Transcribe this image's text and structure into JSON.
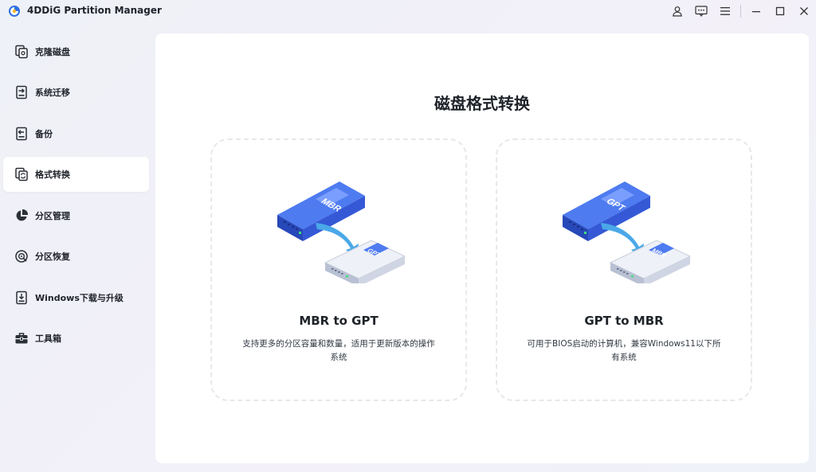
{
  "app": {
    "title": "4DDiG Partition Manager"
  },
  "titlebar": {
    "icons": [
      "user-icon",
      "feedback-icon",
      "menu-icon",
      "minimize-icon",
      "maximize-icon",
      "close-icon"
    ]
  },
  "sidebar": {
    "items": [
      {
        "label": "克隆磁盘",
        "icon": "clone-disk-icon"
      },
      {
        "label": "系统迁移",
        "icon": "system-migrate-icon"
      },
      {
        "label": "备份",
        "icon": "backup-icon"
      },
      {
        "label": "格式转换",
        "icon": "format-convert-icon",
        "active": true
      },
      {
        "label": "分区管理",
        "icon": "partition-pie-icon"
      },
      {
        "label": "分区恢复",
        "icon": "partition-recover-icon"
      },
      {
        "label": "Windows下载与升级",
        "icon": "windows-download-icon"
      },
      {
        "label": "工具箱",
        "icon": "toolbox-icon"
      }
    ]
  },
  "main": {
    "title": "磁盘格式转换",
    "cards": [
      {
        "title": "MBR to GPT",
        "desc": "支持更多的分区容量和数量，适用于更新版本的操作系统",
        "source_label": "MBR",
        "target_label": "GPT"
      },
      {
        "title": "GPT to MBR",
        "desc": "可用于BIOS启动的计算机，兼容Windows11以下所有系统",
        "source_label": "GPT",
        "target_label": "MBR"
      }
    ]
  },
  "colors": {
    "accent": "#3a63e6",
    "accent_light": "#5b86f2",
    "arrow": "#4aa8e8",
    "disk_gray": "#dfe3ec"
  }
}
